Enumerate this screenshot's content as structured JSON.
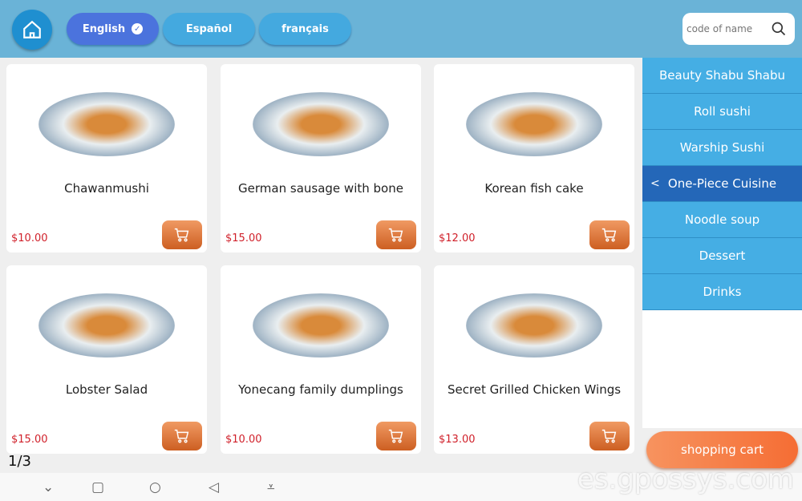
{
  "header": {
    "languages": [
      {
        "label": "English",
        "active": true
      },
      {
        "label": "Español",
        "active": false
      },
      {
        "label": "français",
        "active": false
      }
    ],
    "search_placeholder": "code of name"
  },
  "products": [
    {
      "name": "Chawanmushi",
      "price": "$10.00"
    },
    {
      "name": "German sausage with bone",
      "price": "$15.00"
    },
    {
      "name": "Korean fish cake",
      "price": "$12.00"
    },
    {
      "name": "Lobster Salad",
      "price": "$15.00"
    },
    {
      "name": "Yonecang family dumplings",
      "price": "$10.00"
    },
    {
      "name": "Secret Grilled Chicken Wings",
      "price": "$13.00"
    }
  ],
  "sidebar": {
    "items": [
      {
        "label": "Beauty Shabu Shabu"
      },
      {
        "label": "Roll sushi"
      },
      {
        "label": "Warship Sushi"
      },
      {
        "label": "One-Piece Cuisine",
        "active": true
      },
      {
        "label": "Noodle soup"
      },
      {
        "label": "Dessert"
      },
      {
        "label": "Drinks"
      }
    ],
    "active_chevron": "<"
  },
  "shopping_cart_label": "shopping cart",
  "pagination": "1/3",
  "watermark": "es.gpossys.com",
  "colors": {
    "header": "#6ab3d7",
    "active_lang": "#4b73dd",
    "category": "#45aee4",
    "active_category": "#2467b8",
    "price": "#d0202a",
    "cart": "#f56d34"
  }
}
